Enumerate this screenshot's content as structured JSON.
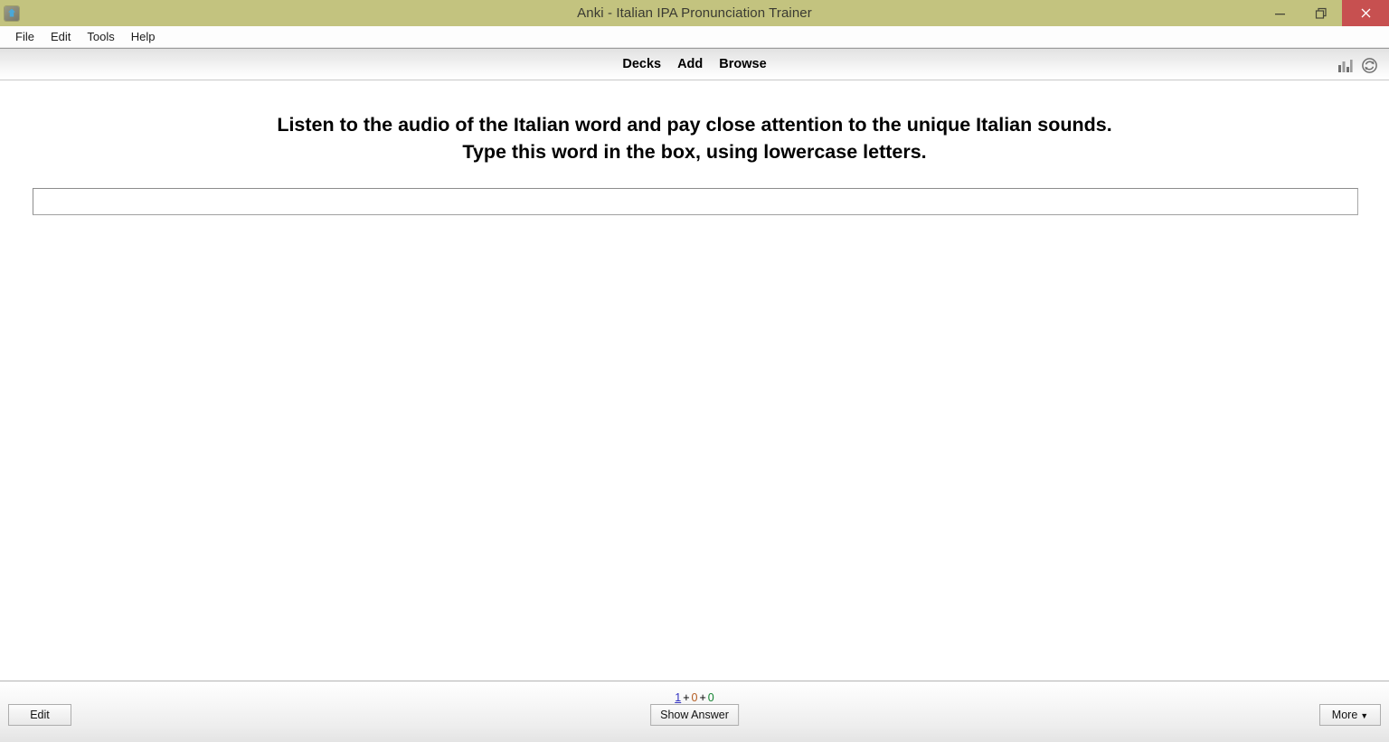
{
  "window": {
    "title": "Anki - Italian IPA Pronunciation Trainer",
    "app_icon": "anki-icon",
    "controls": {
      "minimize": "minimize-icon",
      "restore": "restore-icon",
      "close": "close-icon"
    },
    "colors": {
      "titlebar": "#c3c37f",
      "close_button": "#c75050",
      "new_count": "#3030c0",
      "learn_count": "#b35a1f",
      "due_count": "#11822f"
    }
  },
  "menubar": {
    "items": [
      {
        "label": "File"
      },
      {
        "label": "Edit"
      },
      {
        "label": "Tools"
      },
      {
        "label": "Help"
      }
    ]
  },
  "toolbar": {
    "links": [
      {
        "label": "Decks"
      },
      {
        "label": "Add"
      },
      {
        "label": "Browse"
      }
    ],
    "icons": [
      {
        "name": "stats-bar-chart-icon"
      },
      {
        "name": "sync-icon"
      }
    ]
  },
  "card": {
    "question_line1": "Listen to the audio of the Italian word and pay close attention to the unique Italian sounds.",
    "question_line2": "Type this word in the box, using lowercase letters.",
    "type_answer": {
      "value": "",
      "placeholder": ""
    }
  },
  "bottombar": {
    "counts": {
      "new": "1",
      "learning": "0",
      "due": "0",
      "separator": "+"
    },
    "edit_label": "Edit",
    "show_answer_label": "Show Answer",
    "more_label": "More",
    "more_caret": "▼"
  }
}
